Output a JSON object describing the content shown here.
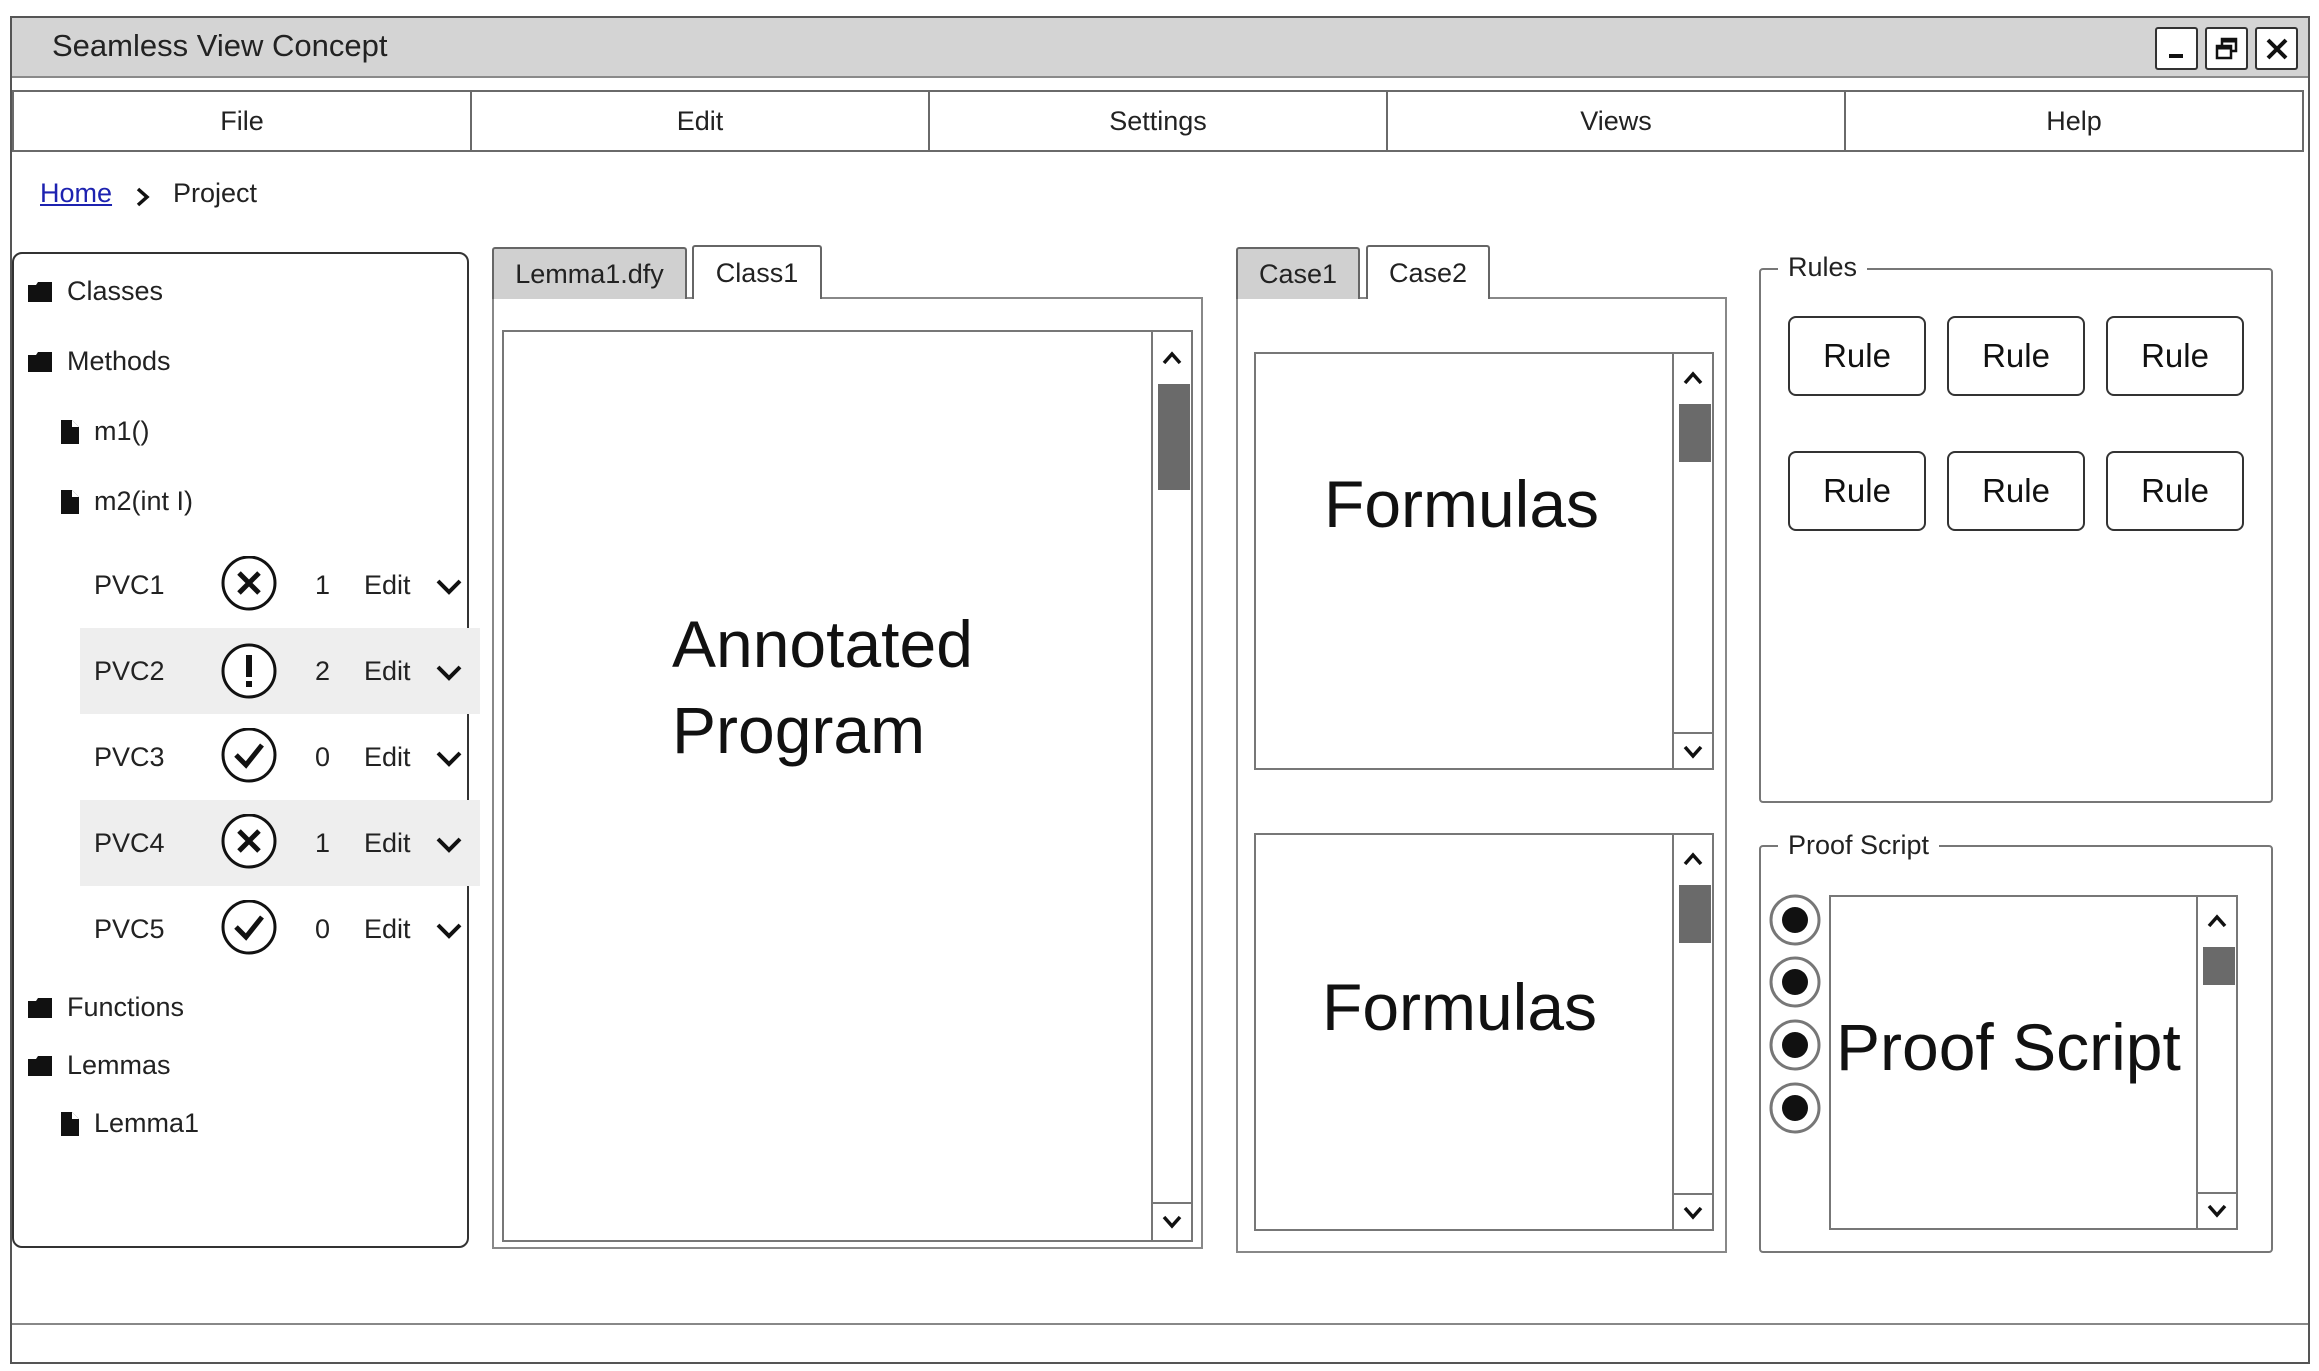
{
  "window": {
    "title": "Seamless View Concept"
  },
  "menu": [
    "File",
    "Edit",
    "Settings",
    "Views",
    "Help"
  ],
  "breadcrumb": {
    "home": "Home",
    "current": "Project"
  },
  "tree": {
    "classes": "Classes",
    "methods": "Methods",
    "method_items": [
      "m1()",
      "m2(int I)"
    ],
    "pvcs": [
      {
        "name": "PVC1",
        "status": "error",
        "count": "1",
        "action": "Edit"
      },
      {
        "name": "PVC2",
        "status": "warning",
        "count": "2",
        "action": "Edit"
      },
      {
        "name": "PVC3",
        "status": "ok",
        "count": "0",
        "action": "Edit"
      },
      {
        "name": "PVC4",
        "status": "error",
        "count": "1",
        "action": "Edit"
      },
      {
        "name": "PVC5",
        "status": "ok",
        "count": "0",
        "action": "Edit"
      }
    ],
    "functions": "Functions",
    "lemmas": "Lemmas",
    "lemma_items": [
      "Lemma1"
    ]
  },
  "program_tabs": {
    "tab1": "Lemma1.dfy",
    "tab2": "Class1",
    "active": "Class1",
    "content_line1": "Annotated",
    "content_line2": "Program"
  },
  "case_tabs": {
    "tab1": "Case1",
    "tab2": "Case2",
    "active": "Case2",
    "formulas_top": "Formulas",
    "formulas_bottom": "Formulas"
  },
  "rules": {
    "legend": "Rules",
    "buttons": [
      "Rule",
      "Rule",
      "Rule",
      "Rule",
      "Rule",
      "Rule"
    ]
  },
  "proof_script": {
    "legend": "Proof Script",
    "content": "Proof Script",
    "radio_count": 4
  }
}
